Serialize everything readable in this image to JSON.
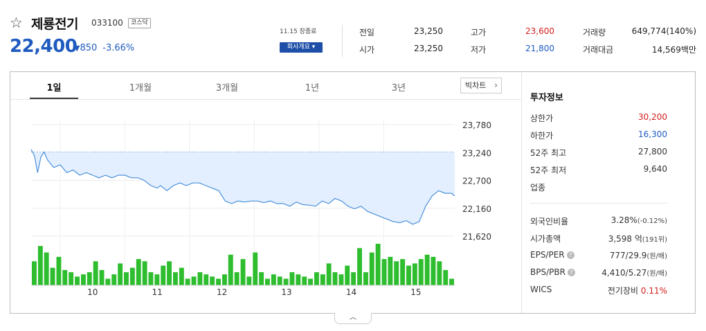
{
  "stock": {
    "name": "제룡전기",
    "code": "033100",
    "market": "코스닥",
    "price": "22,400",
    "change_arrow": "▼",
    "change": "850",
    "change_pct": "-3.66%",
    "date": "11.15 장종료",
    "company_info_button": "회사개요 ▾"
  },
  "quote": {
    "prev_close": {
      "label": "전일",
      "value": "23,250"
    },
    "open": {
      "label": "시가",
      "value": "23,250"
    },
    "high": {
      "label": "고가",
      "value": "23,600"
    },
    "low": {
      "label": "저가",
      "value": "21,800"
    },
    "volume": {
      "label": "거래량",
      "value": "649,774(140%)"
    },
    "amount": {
      "label": "거래대금",
      "value": "14,569백만"
    }
  },
  "tabs": [
    {
      "label": "1일",
      "active": true
    },
    {
      "label": "1개월",
      "active": false
    },
    {
      "label": "3개월",
      "active": false
    },
    {
      "label": "1년",
      "active": false
    },
    {
      "label": "3년",
      "active": false
    }
  ],
  "big_chart_button": "빅차트",
  "chart_data": {
    "type": "area",
    "title": "",
    "xlabel": "",
    "ylabel": "",
    "ylim": [
      21620,
      23780
    ],
    "y_ticks": [
      "23,780",
      "23,240",
      "22,700",
      "22,160",
      "21,620"
    ],
    "y_tick_values": [
      23780,
      23240,
      22700,
      22160,
      21620
    ],
    "x_tick_labels": [
      "10",
      "11",
      "12",
      "13",
      "14",
      "15"
    ],
    "x_tick_positions": [
      10,
      11,
      12,
      13,
      14,
      15
    ],
    "x_range": [
      9.05,
      15.6
    ],
    "reference_line": 23250,
    "colors": {
      "line": "#4a90d9",
      "fill": "#e3efff",
      "volume": "#2ebd2e",
      "reference": "#8fb3dd"
    },
    "series": [
      {
        "values": [
          [
            9.05,
            23300
          ],
          [
            9.1,
            23180
          ],
          [
            9.15,
            22850
          ],
          [
            9.2,
            23150
          ],
          [
            9.25,
            23250
          ],
          [
            9.3,
            23100
          ],
          [
            9.4,
            22950
          ],
          [
            9.5,
            23000
          ],
          [
            9.6,
            22850
          ],
          [
            9.7,
            22900
          ],
          [
            9.8,
            22800
          ],
          [
            9.9,
            22850
          ],
          [
            10.0,
            22800
          ],
          [
            10.1,
            22750
          ],
          [
            10.2,
            22800
          ],
          [
            10.3,
            22750
          ],
          [
            10.4,
            22800
          ],
          [
            10.5,
            22800
          ],
          [
            10.6,
            22750
          ],
          [
            10.7,
            22750
          ],
          [
            10.8,
            22700
          ],
          [
            10.9,
            22600
          ],
          [
            11.0,
            22550
          ],
          [
            11.05,
            22600
          ],
          [
            11.15,
            22500
          ],
          [
            11.25,
            22600
          ],
          [
            11.35,
            22650
          ],
          [
            11.45,
            22600
          ],
          [
            11.55,
            22650
          ],
          [
            11.65,
            22650
          ],
          [
            11.75,
            22600
          ],
          [
            11.85,
            22550
          ],
          [
            11.95,
            22500
          ],
          [
            12.05,
            22300
          ],
          [
            12.15,
            22250
          ],
          [
            12.25,
            22300
          ],
          [
            12.35,
            22280
          ],
          [
            12.45,
            22300
          ],
          [
            12.55,
            22300
          ],
          [
            12.65,
            22270
          ],
          [
            12.75,
            22300
          ],
          [
            12.85,
            22250
          ],
          [
            12.95,
            22250
          ],
          [
            13.05,
            22200
          ],
          [
            13.15,
            22280
          ],
          [
            13.25,
            22230
          ],
          [
            13.35,
            22220
          ],
          [
            13.45,
            22200
          ],
          [
            13.55,
            22300
          ],
          [
            13.65,
            22250
          ],
          [
            13.75,
            22350
          ],
          [
            13.85,
            22300
          ],
          [
            13.95,
            22200
          ],
          [
            14.05,
            22150
          ],
          [
            14.15,
            22200
          ],
          [
            14.25,
            22100
          ],
          [
            14.35,
            22050
          ],
          [
            14.45,
            22000
          ],
          [
            14.55,
            21950
          ],
          [
            14.65,
            21900
          ],
          [
            14.75,
            21880
          ],
          [
            14.85,
            21920
          ],
          [
            14.95,
            21850
          ],
          [
            15.05,
            21900
          ],
          [
            15.15,
            22200
          ],
          [
            15.25,
            22400
          ],
          [
            15.35,
            22500
          ],
          [
            15.45,
            22450
          ],
          [
            15.55,
            22450
          ],
          [
            15.6,
            22400
          ]
        ]
      },
      {
        "name": "",
        "type": "volume",
        "values": [
          11,
          18,
          15,
          8,
          13,
          7,
          6,
          4,
          5,
          6,
          11,
          7,
          3,
          5,
          10,
          6,
          8,
          12,
          11,
          6,
          5,
          9,
          11,
          6,
          8,
          3,
          4,
          6,
          5,
          4,
          3,
          5,
          14,
          6,
          12,
          4,
          15,
          6,
          3,
          5,
          4,
          3,
          6,
          5,
          4,
          3,
          6,
          5,
          10,
          6,
          5,
          9,
          6,
          17,
          6,
          15,
          19,
          12,
          13,
          11,
          12,
          9,
          10,
          12,
          14,
          13,
          11,
          7,
          3
        ]
      }
    ]
  },
  "side": {
    "title": "투자정보",
    "rows_top": [
      {
        "label": "상한가",
        "value": "30,200",
        "color": "red"
      },
      {
        "label": "하한가",
        "value": "16,300",
        "color": "blue"
      },
      {
        "label": "52주 최고",
        "value": "27,800",
        "color": ""
      },
      {
        "label": "52주 최저",
        "value": "9,640",
        "color": ""
      },
      {
        "label": "업종",
        "value": "",
        "color": ""
      }
    ],
    "foreign": {
      "label": "외국인비율",
      "value": "3.28%",
      "sub": "(-0.12%)"
    },
    "market_cap": {
      "label": "시가총액",
      "value": "3,598 억",
      "sub": "(191위)"
    },
    "eps_per": {
      "label": "EPS/PER",
      "value": "777/29.9",
      "sub": "(원/배)"
    },
    "bps_pbr": {
      "label": "BPS/PBR",
      "value": "4,410/5.27",
      "sub": "(원/배)"
    },
    "wics": {
      "label": "WICS",
      "value": "전기장비",
      "pct": "0.11%"
    }
  },
  "collapse_icon": "chevron-up-icon",
  "collapse_glyph": "︿"
}
